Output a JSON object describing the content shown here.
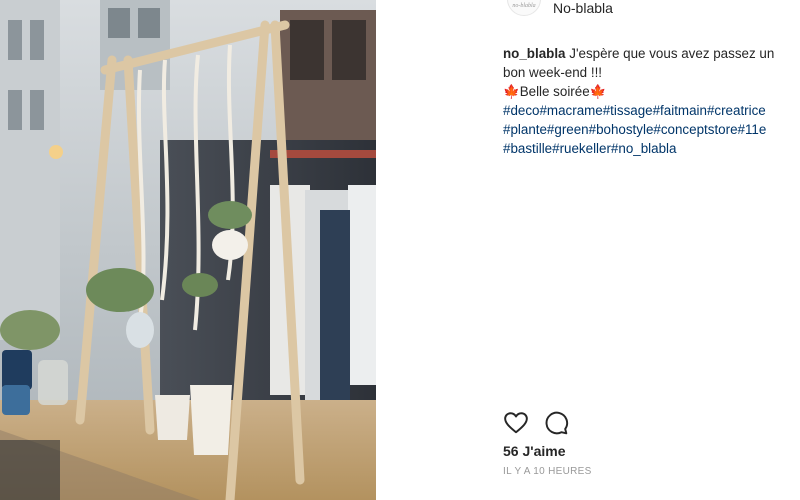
{
  "header": {
    "username": "No-blabla",
    "avatar_text": "no-blabla"
  },
  "caption": {
    "username": "no_blabla",
    "line1": "J'espère que vous avez passez un bon week-end !!!",
    "leaf": "🍁",
    "line2": "Belle soirée",
    "hashtags": "#deco#macrame#tissage#faitmain#creatrice #plante#green#bohostyle#conceptstore#11e #bastille#ruekeller#no_blabla"
  },
  "actions": {
    "like_icon": "heart-icon",
    "comment_icon": "comment-icon"
  },
  "likes": "56 J'aime",
  "time": "IL Y A 10 HEURES",
  "colors": {
    "hashtag": "#003569",
    "text": "#262626",
    "muted": "#999999",
    "leaf": "#d2542a"
  }
}
